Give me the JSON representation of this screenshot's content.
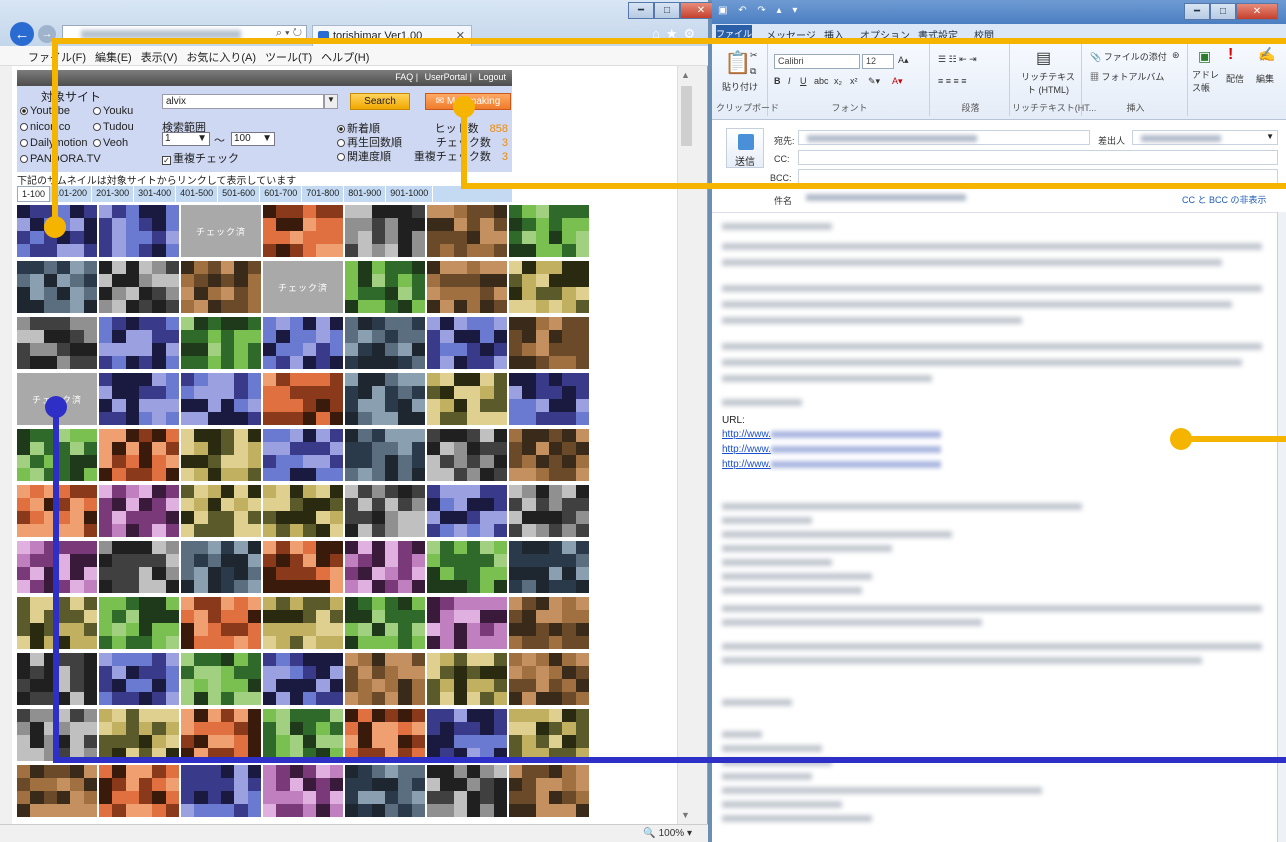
{
  "colors": {
    "orange": "#f5b400",
    "blue": "#2d2fc7",
    "mail_button": "#f07b2a"
  },
  "browser": {
    "tab_title": "torishimar Ver1.00",
    "zoom": "100%",
    "menu": [
      "ファイル(F)",
      "編集(E)",
      "表示(V)",
      "お気に入り(A)",
      "ツール(T)",
      "ヘルプ(H)"
    ]
  },
  "app": {
    "header_links": [
      "FAQ",
      "UserPortal",
      "Logout"
    ],
    "site_label": "対象サイト",
    "sites": [
      "Youtube",
      "Youku",
      "niconico",
      "Tudou",
      "Dailymotion",
      "Veoh",
      "PANDORA.TV"
    ],
    "keyword": "alvix",
    "search_label": "Search",
    "mail_label": "Mail making",
    "range_label": "検索範囲",
    "range_from": "1",
    "range_tilde": "〜",
    "range_to": "100",
    "dup_check_label": "重複チェック",
    "sort_options": [
      "新着順",
      "再生回数順",
      "関連度順"
    ],
    "stats": [
      {
        "label": "ヒット数",
        "value": "858"
      },
      {
        "label": "チェック数",
        "value": "3"
      },
      {
        "label": "重複チェック数",
        "value": "3"
      }
    ],
    "notice": "下記のサムネイルは対象サイトからリンクして表示しています",
    "pages": [
      "1-100",
      "101-200",
      "201-300",
      "301-400",
      "401-500",
      "501-600",
      "601-700",
      "701-800",
      "801-900",
      "901-1000"
    ],
    "checked_label": "チェック済"
  },
  "mail": {
    "file_tab": "ファイル",
    "ribbon_tabs": [
      "メッセージ",
      "挿入",
      "オプション",
      "書式設定",
      "校閲"
    ],
    "font_name": "Calibri",
    "font_size": "12",
    "paste": "貼り付け",
    "groups": [
      "クリップボード",
      "フォント",
      "段落",
      "リッチテキスト(HT...",
      "挿入"
    ],
    "rich_text": "リッチテキスト (HTML)",
    "attach": "ファイルの添付",
    "photo_album": "フォトアルバム",
    "address_book": "アドレス帳",
    "deliver": "配信",
    "edit": "編集",
    "send": "送信",
    "to_label": "宛先:",
    "from_label": "差出人",
    "cc_label": "CC:",
    "bcc_label": "BCC:",
    "subject_label": "件名",
    "cc_bcc_link": "CC と BCC の非表示",
    "url_label": "URL:",
    "link_prefix": "http://www."
  }
}
